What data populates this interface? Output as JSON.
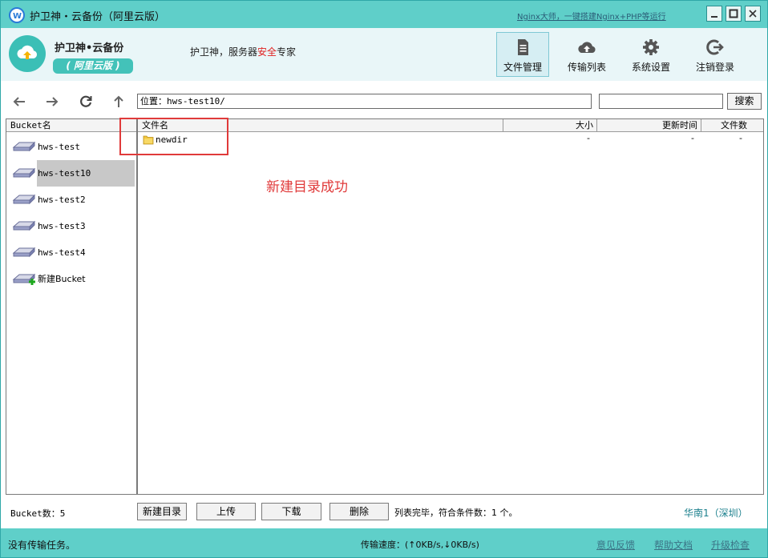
{
  "window": {
    "title": "护卫神・云备份（阿里云版）",
    "promo_link": "Nginx大师，一键搭建Nginx+PHP等运行"
  },
  "header": {
    "brand_name": "护卫神•云备份",
    "edition": "( 阿里云版 )",
    "slogan_a": "护卫神，服务器",
    "slogan_red": "安全",
    "slogan_b": "专家",
    "tabs": [
      {
        "label": "文件管理",
        "icon": "file-list-icon",
        "active": true
      },
      {
        "label": "传输列表",
        "icon": "cloud-upload-icon",
        "active": false
      },
      {
        "label": "系统设置",
        "icon": "gear-icon",
        "active": false
      },
      {
        "label": "注销登录",
        "icon": "logout-icon",
        "active": false
      }
    ]
  },
  "toolbar": {
    "path_prefix": "位置：",
    "path_value": "hws-test10/",
    "search_placeholder": "",
    "search_label": "搜索"
  },
  "buckets": {
    "header": "Bucket名",
    "items": [
      "hws-test",
      "hws-test10",
      "hws-test2",
      "hws-test3",
      "hws-test4"
    ],
    "selected": "hws-test10",
    "new_label": "新建Bucket"
  },
  "files": {
    "headers": {
      "name": "文件名",
      "size": "大小",
      "time": "更新时间",
      "count": "文件数"
    },
    "rows": [
      {
        "name": "newdir",
        "size": "-",
        "time": "-",
        "count": "-"
      }
    ]
  },
  "annotation": "新建目录成功",
  "actions": {
    "bucket_count": "Bucket数：5",
    "new_dir": "新建目录",
    "upload": "上传",
    "download": "下载",
    "delete": "删除",
    "list_status": "列表完毕，符合条件数：1 个。",
    "region": "华南1（深圳）"
  },
  "status": {
    "task": "没有传输任务。",
    "speed": "传输速度：(↑0KB/s,↓0KB/s)",
    "feedback": "意见反馈",
    "help": "帮助文档",
    "upgrade": "升级检查"
  },
  "colors": {
    "titlebar": "#5fcfc9",
    "header_bg": "#e9f6f8",
    "annotation_red": "#e03a3a",
    "selection_gray": "#c8c8c8"
  }
}
